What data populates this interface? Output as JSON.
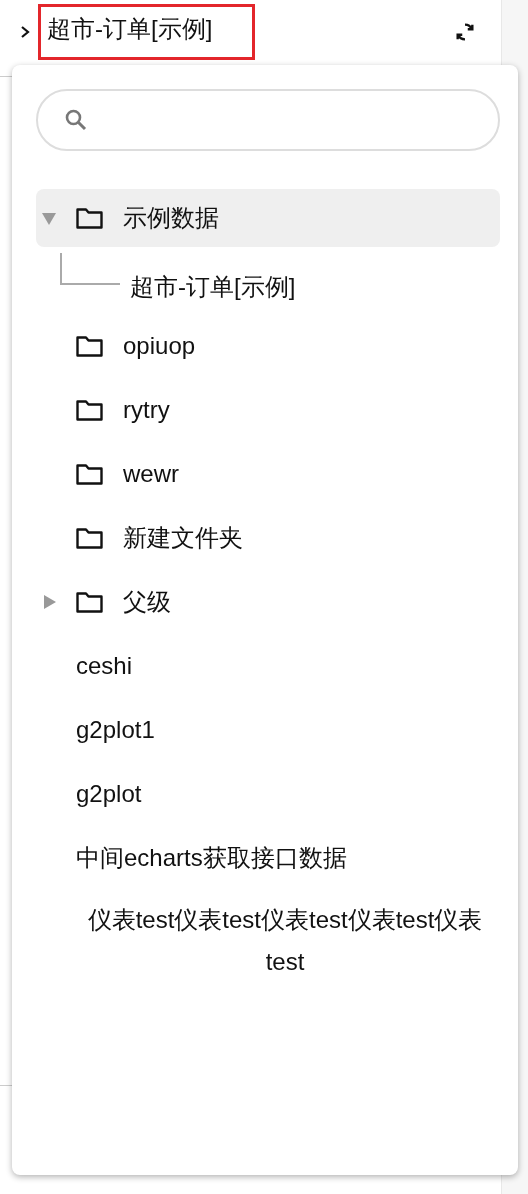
{
  "header": {
    "title": "超市-订单[示例]"
  },
  "tree": [
    {
      "kind": "folder",
      "label": "示例数据",
      "expanded": true,
      "selected": true,
      "children": [
        {
          "kind": "leaf",
          "label": "超市-订单[示例]"
        }
      ]
    },
    {
      "kind": "folder",
      "label": "opiuop",
      "selected": false
    },
    {
      "kind": "folder",
      "label": "rytry",
      "selected": false
    },
    {
      "kind": "folder",
      "label": "wewr",
      "selected": false
    },
    {
      "kind": "folder",
      "label": "新建文件夹",
      "selected": false
    },
    {
      "kind": "folder",
      "label": "父级",
      "expanded": false,
      "selected": false
    },
    {
      "kind": "leaf",
      "label": "ceshi",
      "selected": false
    },
    {
      "kind": "leaf",
      "label": "g2plot1",
      "selected": false
    },
    {
      "kind": "leaf",
      "label": "g2plot",
      "selected": false
    },
    {
      "kind": "leaf",
      "label": "中间echarts获取接口数据",
      "selected": false
    },
    {
      "kind": "leaf",
      "label": "仪表test仪表test仪表test仪表test仪表test",
      "selected": false
    }
  ]
}
